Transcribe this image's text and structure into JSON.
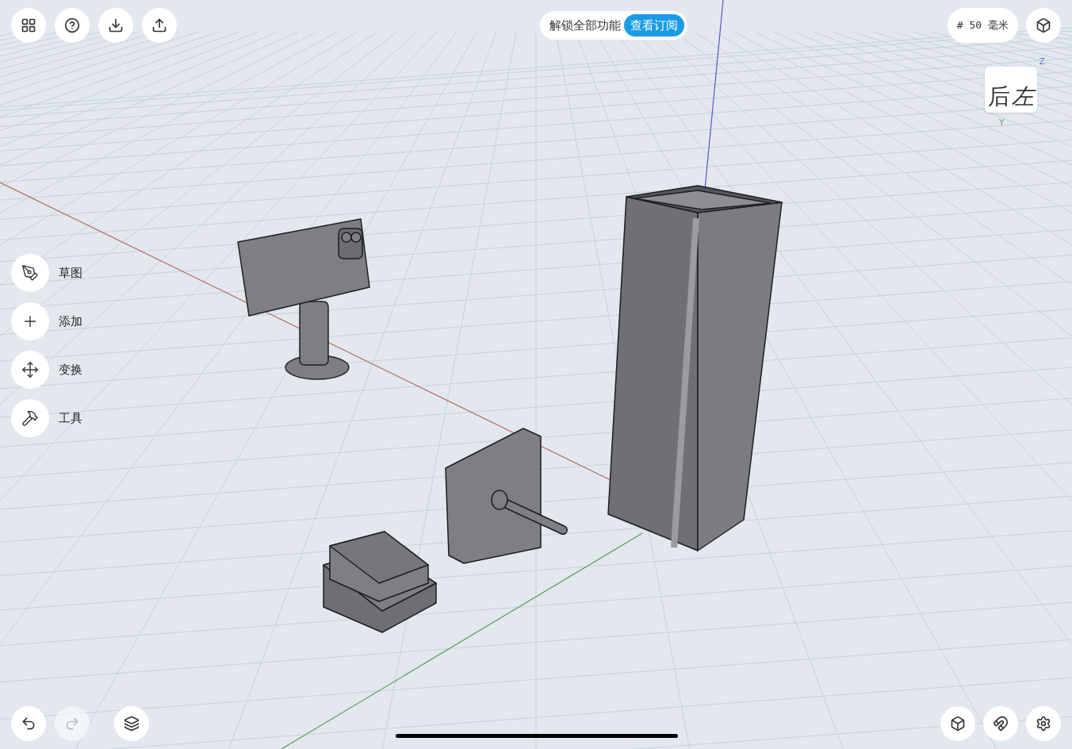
{
  "promo": {
    "text": "解锁全部功能",
    "button": "查看订阅"
  },
  "grid_size": "# 50 毫米",
  "view_cube": {
    "faces": [
      "后",
      "左"
    ],
    "axes": [
      "Z",
      "Y"
    ]
  },
  "tools": [
    {
      "label": "草图",
      "kind": "sketch"
    },
    {
      "label": "添加",
      "kind": "add"
    },
    {
      "label": "变换",
      "kind": "transform"
    },
    {
      "label": "工具",
      "kind": "tool"
    }
  ],
  "history": {
    "undo_disabled": false,
    "redo_disabled": true
  }
}
